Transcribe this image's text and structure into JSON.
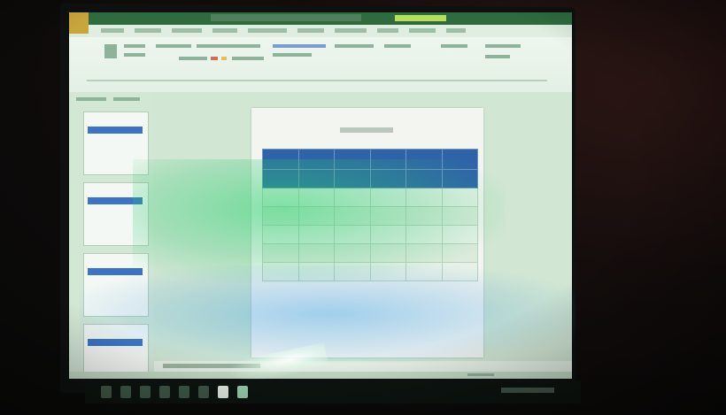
{
  "photo": {
    "subject": "monitor-showing-presentation-app",
    "colors": {
      "title_bar": "#2f6b3f",
      "file_tab": "#c9a53e",
      "table_header": "#2f63a8",
      "screen_tint": "#d9ecd8",
      "room": "#0c0d0b"
    }
  },
  "app": {
    "slide_thumbnails": [
      {
        "id": "thumb-1"
      },
      {
        "id": "thumb-2"
      },
      {
        "id": "thumb-3"
      },
      {
        "id": "thumb-4"
      }
    ],
    "slide": {
      "table": {
        "rows_shown": 7
      }
    }
  }
}
